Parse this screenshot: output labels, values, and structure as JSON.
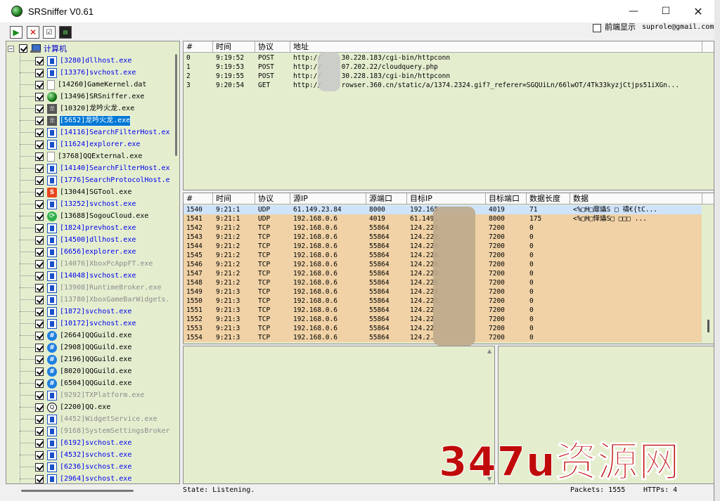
{
  "window": {
    "title": "SRSniffer V0.61"
  },
  "controls": {
    "minimize": "—",
    "maximize": "☐",
    "close": "✕"
  },
  "toolbar": {
    "front_display": "前端显示",
    "email": "suprole@gmail.com"
  },
  "tree": {
    "root_label": "计算机",
    "items": [
      {
        "label": "[3280]dllhost.exe",
        "icon": "window-icon",
        "style": "blue"
      },
      {
        "label": "[13376]svchost.exe",
        "icon": "window-icon",
        "style": "blue"
      },
      {
        "label": "[14260]GameKernel.dat",
        "icon": "document-icon",
        "style": "black"
      },
      {
        "label": "[13496]SRSniffer.exe",
        "icon": "ball-icon",
        "style": "black"
      },
      {
        "label": "[10320]龙吟火龙.exe",
        "icon": "dragon-icon",
        "style": "black"
      },
      {
        "label": "[5652]龙吟火龙.exe",
        "icon": "dragon-icon",
        "style": "selected"
      },
      {
        "label": "[14116]SearchFilterHost.ex",
        "icon": "window-icon",
        "style": "blue"
      },
      {
        "label": "[11624]explorer.exe",
        "icon": "window-icon",
        "style": "blue"
      },
      {
        "label": "[3768]QQExternal.exe",
        "icon": "document-icon",
        "style": "black"
      },
      {
        "label": "[14140]SearchFilterHost.ex",
        "icon": "window-icon",
        "style": "blue"
      },
      {
        "label": "[1776]SearchProtocolHost.e",
        "icon": "window-icon",
        "style": "blue"
      },
      {
        "label": "[13044]SGTool.exe",
        "icon": "sgtool-icon",
        "style": "black"
      },
      {
        "label": "[13252]svchost.exe",
        "icon": "window-icon",
        "style": "blue"
      },
      {
        "label": "[13688]SogouCloud.exe",
        "icon": "sogou-icon",
        "style": "black"
      },
      {
        "label": "[1824]prevhost.exe",
        "icon": "window-icon",
        "style": "blue"
      },
      {
        "label": "[14500]dllhost.exe",
        "icon": "window-icon",
        "style": "blue"
      },
      {
        "label": "[6656]explorer.exe",
        "icon": "window-icon",
        "style": "blue"
      },
      {
        "label": "[14076]XboxPcAppFT.exe",
        "icon": "window-icon",
        "style": "gray"
      },
      {
        "label": "[14048]svchost.exe",
        "icon": "window-icon",
        "style": "blue"
      },
      {
        "label": "[13908]RuntimeBroker.exe",
        "icon": "window-icon",
        "style": "gray"
      },
      {
        "label": "[13780]XboxGameBarWidgets.",
        "icon": "window-icon",
        "style": "gray"
      },
      {
        "label": "[1872]svchost.exe",
        "icon": "window-icon",
        "style": "blue"
      },
      {
        "label": "[10172]svchost.exe",
        "icon": "window-icon",
        "style": "blue"
      },
      {
        "label": "[2664]QQGuild.exe",
        "icon": "qqguild-icon",
        "style": "black"
      },
      {
        "label": "[2908]QQGuild.exe",
        "icon": "qqguild-icon",
        "style": "black"
      },
      {
        "label": "[2196]QQGuild.exe",
        "icon": "qqguild-icon",
        "style": "black"
      },
      {
        "label": "[8020]QQGuild.exe",
        "icon": "qqguild-icon",
        "style": "black"
      },
      {
        "label": "[6504]QQGuild.exe",
        "icon": "qqguild-icon",
        "style": "black"
      },
      {
        "label": "[9292]TXPlatform.exe",
        "icon": "window-icon",
        "style": "gray"
      },
      {
        "label": "[2200]QQ.exe",
        "icon": "qq-icon",
        "style": "black"
      },
      {
        "label": "[4452]WidgetService.exe",
        "icon": "window-icon",
        "style": "gray"
      },
      {
        "label": "[9168]SystemSettingsBroker",
        "icon": "window-icon",
        "style": "gray"
      },
      {
        "label": "[6192]svchost.exe",
        "icon": "window-icon",
        "style": "blue"
      },
      {
        "label": "[4532]svchost.exe",
        "icon": "window-icon",
        "style": "blue"
      },
      {
        "label": "[6236]svchost.exe",
        "icon": "window-icon",
        "style": "blue"
      },
      {
        "label": "[2964]svchost.exe",
        "icon": "window-icon",
        "style": "blue"
      }
    ]
  },
  "http_table": {
    "headers": [
      "#",
      "时间",
      "协议",
      "地址"
    ],
    "rows": [
      [
        "0",
        "9:19:52",
        "POST",
        "http://     30.228.183/cgi-bin/httpconn"
      ],
      [
        "1",
        "9:19:53",
        "POST",
        "http://     07.202.22/cloudquery.php"
      ],
      [
        "2",
        "9:19:55",
        "POST",
        "http://     30.228.183/cgi-bin/httpconn"
      ],
      [
        "3",
        "9:20:54",
        "GET",
        "http://     rowser.360.cn/static/a/1374.2324.gif?_referer=SGQUiLn/66lwOT/4Tk33kyzjCtjps51iXGn..."
      ]
    ]
  },
  "packet_table": {
    "headers": [
      "#",
      "时间",
      "协议",
      "源IP",
      "源端口",
      "目标IP",
      "目标端口",
      "数据长度",
      "数据"
    ],
    "rows": [
      [
        "1540",
        "9:21:1",
        "UDP",
        "61.149.23.84",
        "8000",
        "192.168.",
        "4019",
        "71",
        "<%□H□靡爞S □ 禱€{tC..."
      ],
      [
        "1541",
        "9:21:1",
        "UDP",
        "192.168.0.6",
        "4019",
        "61.149.",
        "8000",
        "175",
        "<%□H□怿爞S□  □□□ ..."
      ],
      [
        "1542",
        "9:21:2",
        "TCP",
        "192.168.0.6",
        "55864",
        "124.220.",
        "7200",
        "0",
        ""
      ],
      [
        "1543",
        "9:21:2",
        "TCP",
        "192.168.0.6",
        "55864",
        "124.220.",
        "7200",
        "0",
        ""
      ],
      [
        "1544",
        "9:21:2",
        "TCP",
        "192.168.0.6",
        "55864",
        "124.220.",
        "7200",
        "0",
        ""
      ],
      [
        "1545",
        "9:21:2",
        "TCP",
        "192.168.0.6",
        "55864",
        "124.220.",
        "7200",
        "0",
        ""
      ],
      [
        "1546",
        "9:21:2",
        "TCP",
        "192.168.0.6",
        "55864",
        "124.220.",
        "7200",
        "0",
        ""
      ],
      [
        "1547",
        "9:21:2",
        "TCP",
        "192.168.0.6",
        "55864",
        "124.220.",
        "7200",
        "0",
        ""
      ],
      [
        "1548",
        "9:21:2",
        "TCP",
        "192.168.0.6",
        "55864",
        "124.220.",
        "7200",
        "0",
        ""
      ],
      [
        "1549",
        "9:21:3",
        "TCP",
        "192.168.0.6",
        "55864",
        "124.220.",
        "7200",
        "0",
        ""
      ],
      [
        "1550",
        "9:21:3",
        "TCP",
        "192.168.0.6",
        "55864",
        "124.220.",
        "7200",
        "0",
        ""
      ],
      [
        "1551",
        "9:21:3",
        "TCP",
        "192.168.0.6",
        "55864",
        "124.22.",
        "7200",
        "0",
        ""
      ],
      [
        "1552",
        "9:21:3",
        "TCP",
        "192.168.0.6",
        "55864",
        "124.22.",
        "7200",
        "0",
        ""
      ],
      [
        "1553",
        "9:21:3",
        "TCP",
        "192.168.0.6",
        "55864",
        "124.22.",
        "7200",
        "0",
        ""
      ],
      [
        "1554",
        "9:21:3",
        "TCP",
        "192.168.0.6",
        "55864",
        "124.2.",
        "7200",
        "0",
        ""
      ]
    ]
  },
  "status": {
    "state": "State: Listening.",
    "packets": "Packets: 1555",
    "https": "HTTPs: 4"
  },
  "watermark": {
    "text": "347u资源网"
  },
  "colors": {
    "selected_row": "#cfe3fb",
    "tcp_row": "#f0d2a6",
    "grid_bg": "#e4eecf",
    "watermark": "#c00a0a"
  }
}
